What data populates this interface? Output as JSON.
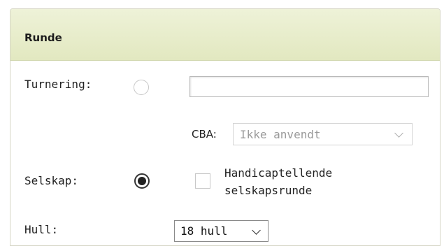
{
  "panel": {
    "title": "Runde"
  },
  "form": {
    "turnering_label": "Turnering:",
    "turnering_value": "",
    "cba_label": "CBA:",
    "cba_value": "Ikke anvendt",
    "selskap_label": "Selskap:",
    "handicap_label": "Handicaptellende selskapsrunde",
    "handicap_checked": false,
    "hull_label": "Hull:",
    "hull_value": "18 hull",
    "selected_round_type": "Selskap"
  },
  "icons": {
    "cba_dropdown": "chevron-down-icon",
    "hull_dropdown": "chevron-down-icon"
  },
  "colors": {
    "header_bg": "#e6ebc8",
    "panel_border": "#d6d6c6"
  }
}
